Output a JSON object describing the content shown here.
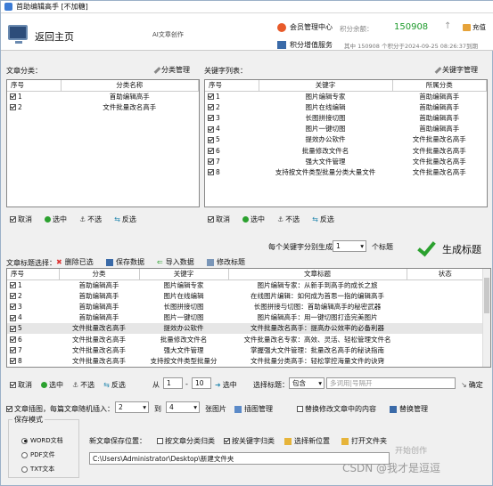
{
  "window": {
    "title": "首助编辑高手 [不加糖]"
  },
  "header": {
    "back_label": "返回主页",
    "ai_label": "AI文章创作",
    "member_center": "会员管理中心",
    "balance_label": "积分余额：",
    "balance": "150908",
    "recharge": "充值",
    "service": "积分增值服务",
    "service_info": "其中 150908 个积分于2024-09-25 08:26:37到期"
  },
  "categories": {
    "label": "文章分类：",
    "manage": "分类管理",
    "columns": [
      "序号",
      "分类名称"
    ],
    "rows": [
      {
        "no": "1",
        "name": "首助编辑高手",
        "checked": true
      },
      {
        "no": "2",
        "name": "文件批量改名高手",
        "checked": true
      }
    ],
    "actions": [
      "取消",
      "选中",
      "不选",
      "反选"
    ]
  },
  "keywords": {
    "label": "关键字列表：",
    "manage": "关键字管理",
    "columns": [
      "序号",
      "关键字",
      "所属分类"
    ],
    "rows": [
      {
        "no": "1",
        "kw": "图片编辑专家",
        "cat": "首助编辑高手",
        "checked": true
      },
      {
        "no": "2",
        "kw": "图片在线编辑",
        "cat": "首助编辑高手",
        "checked": true
      },
      {
        "no": "3",
        "kw": "长图拼接切图",
        "cat": "首助编辑高手",
        "checked": true
      },
      {
        "no": "4",
        "kw": "图片一键切图",
        "cat": "首助编辑高手",
        "checked": true
      },
      {
        "no": "5",
        "kw": "提效办公软件",
        "cat": "文件批量改名高手",
        "checked": true
      },
      {
        "no": "6",
        "kw": "批量修改文件名",
        "cat": "文件批量改名高手",
        "checked": true
      },
      {
        "no": "7",
        "kw": "强大文件管理",
        "cat": "文件批量改名高手",
        "checked": true
      },
      {
        "no": "8",
        "kw": "支持按文件类型批量分类大量文件",
        "cat": "文件批量改名高手",
        "checked": true
      }
    ],
    "actions": [
      "取消",
      "选中",
      "不选",
      "反选"
    ]
  },
  "titles": {
    "label": "文章标题选择：",
    "delete": "删除已选",
    "save": "保存数据",
    "import": "导入数据",
    "edit": "修改标题",
    "per_kw_label": "每个关键字分别生成：",
    "per_kw_value": "1",
    "per_kw_unit": "个标题",
    "generate": "生成标题",
    "columns": [
      "序号",
      "分类",
      "关键字",
      "文章标题",
      "状态"
    ],
    "rows": [
      {
        "no": "1",
        "cat": "首助编辑高手",
        "kw": "图片编辑专家",
        "title": "图片编辑专家：从新手到高手的成长之旅"
      },
      {
        "no": "2",
        "cat": "首助编辑高手",
        "kw": "图片在线编辑",
        "title": "在线图片编辑：如何成为首思一指的编辑高手"
      },
      {
        "no": "3",
        "cat": "首助编辑高手",
        "kw": "长图拼接切图",
        "title": "长图拼接与切图：首助编辑高手的秘密武器"
      },
      {
        "no": "4",
        "cat": "首助编辑高手",
        "kw": "图片一键切图",
        "title": "图片编辑高手：用一键切图打造完美图片"
      },
      {
        "no": "5",
        "cat": "文件批量改名高手",
        "kw": "提效办公软件",
        "title": "文件批量改名高手：提高办公效率的必备利器"
      },
      {
        "no": "6",
        "cat": "文件批量改名高手",
        "kw": "批量修改文件名",
        "title": "文件批量改名专家：高效、灵活、轻松管理文件名"
      },
      {
        "no": "7",
        "cat": "文件批量改名高手",
        "kw": "强大文件管理",
        "title": "掌握强大文件管理：批量改名高手的秘诀指南"
      },
      {
        "no": "8",
        "cat": "文件批量改名高手",
        "kw": "支持按文件类型批量分",
        "title": "文件批量分类高手：轻松掌控海量文件的诀窍"
      }
    ],
    "actions": [
      "取消",
      "选中",
      "不选",
      "反选"
    ],
    "from_label": "从",
    "range_from": "1",
    "range_to": "10",
    "select_label": "选中",
    "choose_title": "选择标题：",
    "contains": "包含",
    "multi_hint": "多词用|号隔开",
    "confirm": "确定"
  },
  "options": {
    "insert_label": "文章插图，每篇文章随机插入：",
    "ins_from": "2",
    "to": "到",
    "ins_to": "4",
    "unit": "张图片",
    "insert_manage": "插图管理",
    "replace_label": "替换修改文章中的内容",
    "replace_manage": "替换管理"
  },
  "save": {
    "group": "保存模式",
    "modes": [
      "WORD文档",
      "PDF文件",
      "TXT文本"
    ],
    "location_label": "新文章保存位置：",
    "by_category": "按文章分类归类",
    "by_keyword": "按关键字归类",
    "choose_location": "选择新位置",
    "open_folder": "打开文件夹",
    "path": "C:\\Users\\Administrator\\Desktop\\新建文件夹",
    "start": "开始创作"
  },
  "watermark": "CSDN @我才是逗逗"
}
